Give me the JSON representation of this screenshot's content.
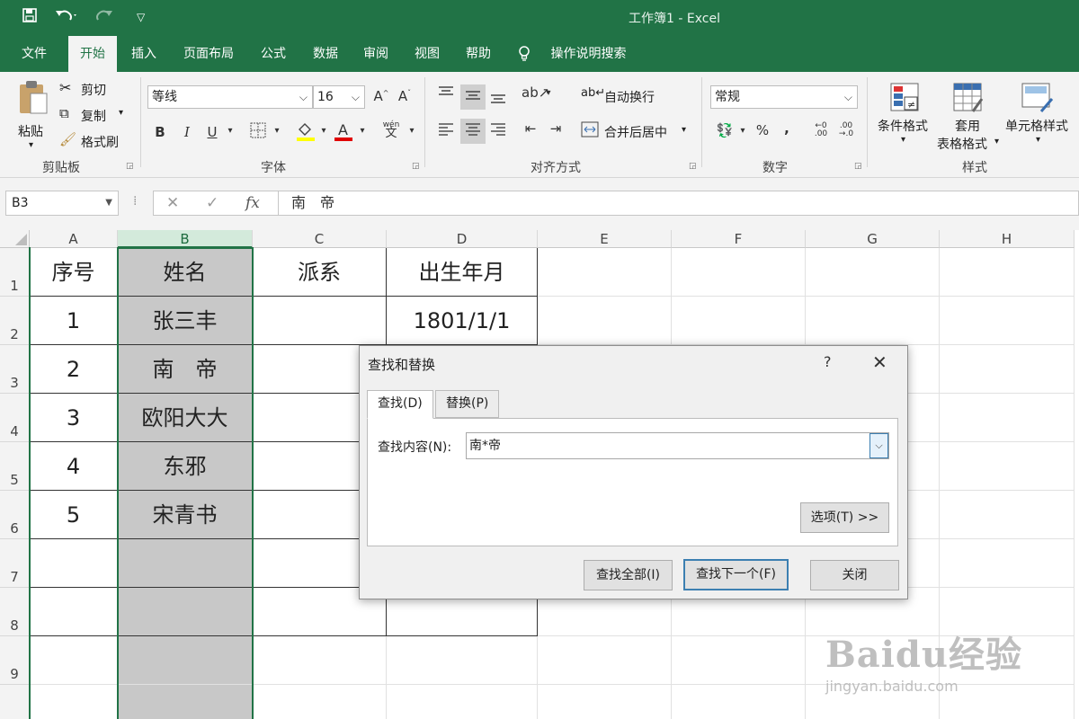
{
  "quick_access": {
    "save_icon": "save-icon",
    "undo_icon": "undo-icon",
    "redo_icon": "redo-icon",
    "customize_icon": "customize-icon"
  },
  "window": {
    "title": "工作簿1 - Excel"
  },
  "menu": {
    "tabs": [
      "文件",
      "开始",
      "插入",
      "页面布局",
      "公式",
      "数据",
      "审阅",
      "视图",
      "帮助"
    ],
    "tell_me": "操作说明搜索",
    "active_tab": "开始"
  },
  "ribbon": {
    "clipboard": {
      "paste": "粘贴",
      "cut": "剪切",
      "copy": "复制",
      "format_painter": "格式刷",
      "label": "剪贴板"
    },
    "font": {
      "name": "等线",
      "size": "16",
      "label": "字体",
      "bold": "B",
      "italic": "I",
      "underline": "U",
      "wen": "wén",
      "wen_char": "文"
    },
    "alignment": {
      "wrap": "自动换行",
      "merge": "合并后居中",
      "label": "对齐方式"
    },
    "number": {
      "format": "常规",
      "percent": "%",
      "comma": ",",
      "label": "数字"
    },
    "styles": {
      "conditional": "条件格式",
      "table_line1": "套用",
      "table_line2": "表格格式",
      "cell_styles": "单元格样式",
      "label": "样式"
    }
  },
  "formula_bar": {
    "name_box": "B3",
    "fx": "fx",
    "content": "南　帝"
  },
  "sheet": {
    "columns": [
      "A",
      "B",
      "C",
      "D",
      "E",
      "F",
      "G",
      "H"
    ],
    "selected_column": "B",
    "rows": [
      "1",
      "2",
      "3",
      "4",
      "5",
      "6",
      "7",
      "8",
      "9"
    ],
    "data": [
      [
        "序号",
        "姓名",
        "派系",
        "出生年月"
      ],
      [
        "1",
        "张三丰",
        "",
        "1801/1/1"
      ],
      [
        "2",
        "南　帝",
        "",
        ""
      ],
      [
        "3",
        "欧阳大大",
        "",
        ""
      ],
      [
        "4",
        "东邪",
        "",
        ""
      ],
      [
        "5",
        "宋青书",
        "",
        ""
      ]
    ]
  },
  "dialog": {
    "title": "查找和替换",
    "help": "?",
    "close": "✕",
    "tabs": [
      "查找(D)",
      "替换(P)"
    ],
    "find_label": "查找内容(N):",
    "find_value": "南*帝",
    "options_button": "选项(T) >>",
    "find_all_button": "查找全部(I)",
    "find_next_button": "查找下一个(F)",
    "close_button": "关闭"
  },
  "watermark": {
    "line1": "Baidu经验",
    "line2": "jingyan.baidu.com"
  }
}
